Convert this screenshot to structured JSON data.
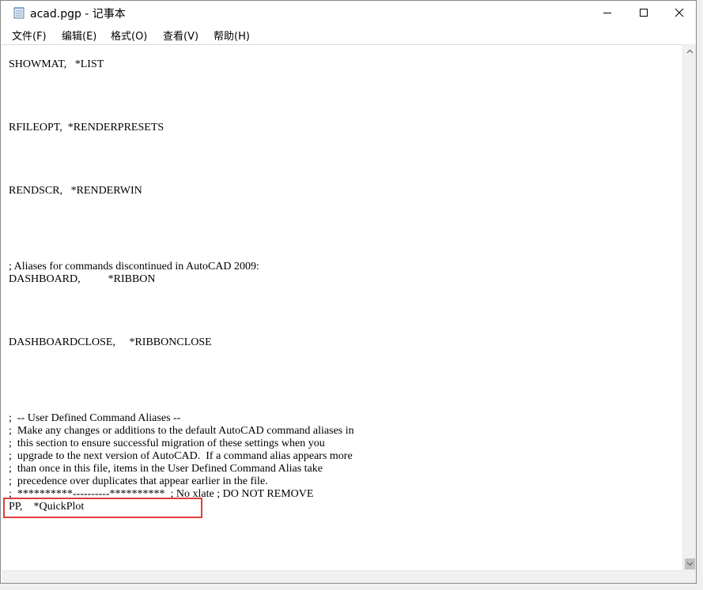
{
  "window": {
    "title": "acad.pgp - 记事本"
  },
  "menu": [
    {
      "label": "文件(F)"
    },
    {
      "label": "编辑(E)"
    },
    {
      "label": "格式(O)"
    },
    {
      "label": "查看(V)"
    },
    {
      "label": "帮助(H)"
    }
  ],
  "editor": {
    "lines": [
      "SHOWMAT,   *LIST",
      "",
      "",
      "",
      "",
      "RFILEOPT,  *RENDERPRESETS",
      "",
      "",
      "",
      "",
      "RENDSCR,   *RENDERWIN",
      "",
      "",
      "",
      "",
      "",
      "; Aliases for commands discontinued in AutoCAD 2009:",
      "DASHBOARD,          *RIBBON",
      "",
      "",
      "",
      "",
      "DASHBOARDCLOSE,     *RIBBONCLOSE",
      "",
      "",
      "",
      "",
      "",
      ";  -- User Defined Command Aliases --",
      ";  Make any changes or additions to the default AutoCAD command aliases in",
      ";  this section to ensure successful migration of these settings when you",
      ";  upgrade to the next version of AutoCAD.  If a command alias appears more",
      ";  than once in this file, items in the User Defined Command Alias take",
      ";  precedence over duplicates that appear earlier in the file.",
      ";  **********----------**********  ; No xlate ; DO NOT REMOVE",
      "PP,    *QuickPlot"
    ]
  },
  "colors": {
    "highlight_border": "#e03c3c",
    "scrollbar_bg": "#f0f0f0",
    "scroll_thumb": "#c1c1c1"
  }
}
